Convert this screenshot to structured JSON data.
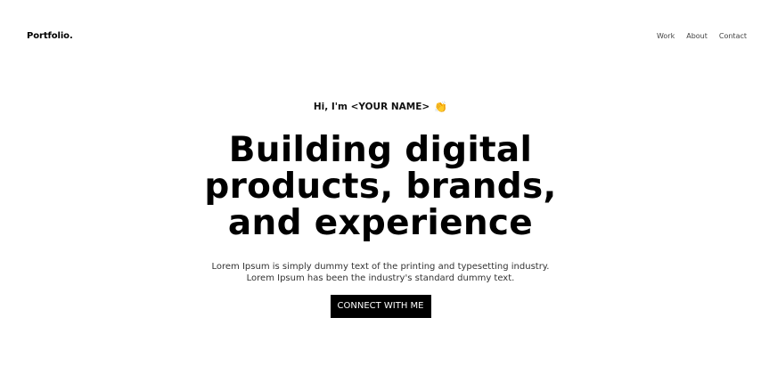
{
  "header": {
    "logo": "Portfolio.",
    "nav": [
      "Work",
      "About",
      "Contact"
    ]
  },
  "hero": {
    "greeting": "Hi, I'm <YOUR NAME>",
    "greeting_emoji": "👏",
    "headline_lines": [
      "Building digital",
      "products, brands,",
      "and experience"
    ],
    "description_lines": [
      "Lorem Ipsum is simply dummy text of the printing and typesetting industry.",
      "Lorem Ipsum has been the industry's standard dummy text."
    ],
    "cta_label": "CONNECT WITH ME"
  },
  "colors": {
    "background": "#ffffff",
    "text": "#000000",
    "button_bg": "#000000",
    "button_text": "#ffffff"
  }
}
